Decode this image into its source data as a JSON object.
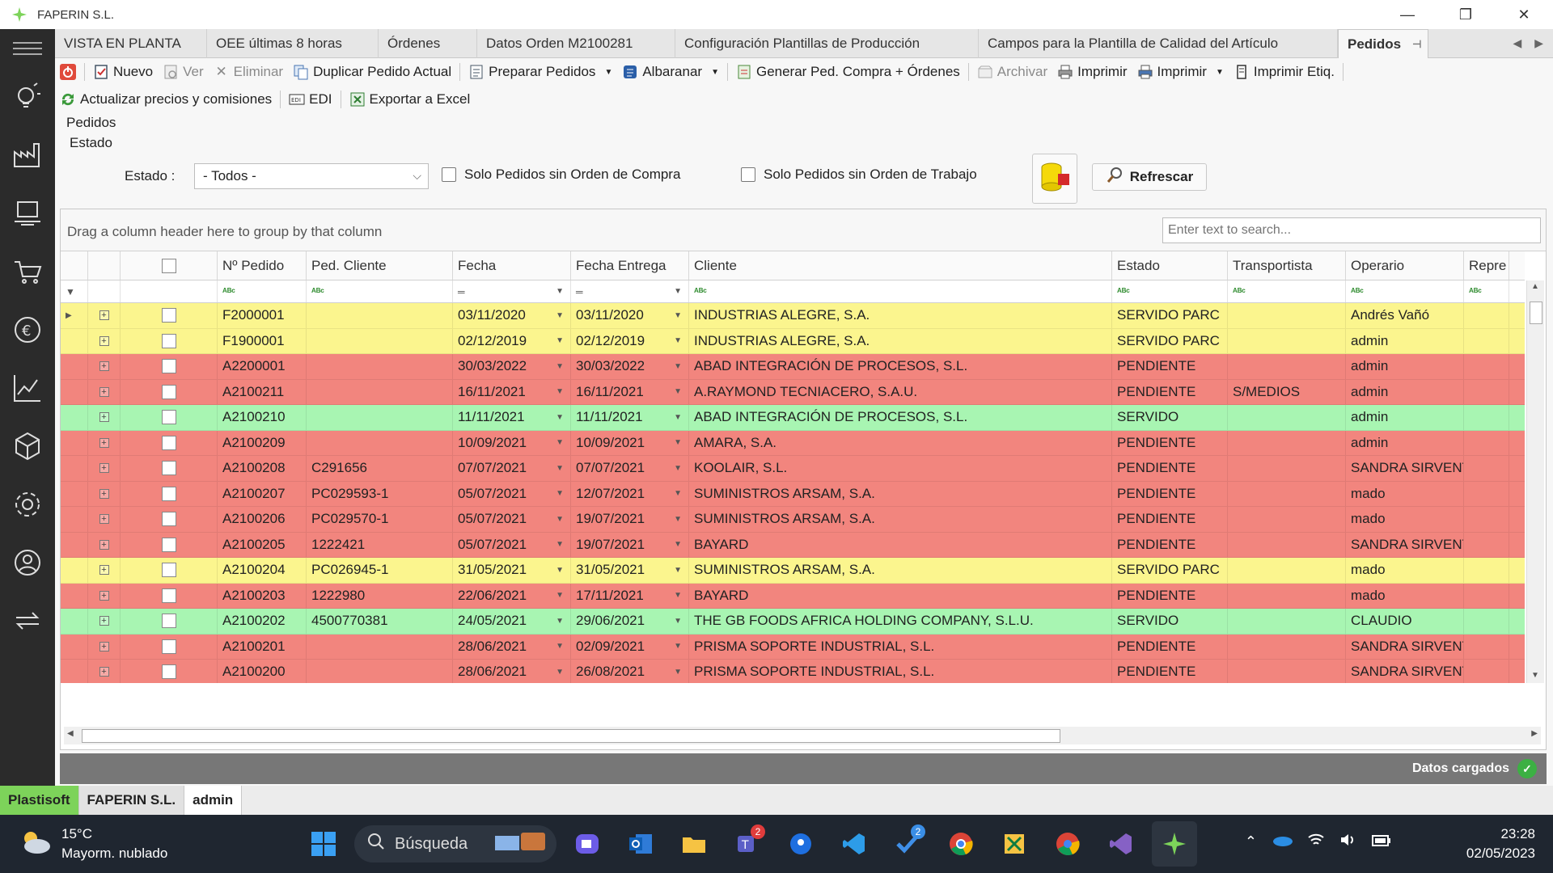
{
  "window": {
    "title": "FAPERIN S.L."
  },
  "tabs": [
    {
      "label": "VISTA EN PLANTA"
    },
    {
      "label": "OEE últimas 8 horas"
    },
    {
      "label": "Órdenes"
    },
    {
      "label": "Datos Orden M2100281"
    },
    {
      "label": "Configuración Plantillas de Producción"
    },
    {
      "label": "Campos para la Plantilla de Calidad del Artículo"
    },
    {
      "label": "Pedidos",
      "active": true
    }
  ],
  "toolbar": {
    "nuevo": "Nuevo",
    "ver": "Ver",
    "eliminar": "Eliminar",
    "duplicar": "Duplicar Pedido Actual",
    "preparar": "Preparar Pedidos",
    "albaranar": "Albaranar",
    "generar": "Generar Ped. Compra + Órdenes",
    "archivar": "Archivar",
    "imprimir1": "Imprimir",
    "imprimir2": "Imprimir",
    "imprimir_etiq": "Imprimir Etiq.",
    "actualizar": "Actualizar precios y comisiones",
    "edi": "EDI",
    "exportar": "Exportar a Excel"
  },
  "panel": {
    "pedidos_label": "Pedidos",
    "estado_group": "Estado",
    "estado_label": "Estado :",
    "estado_value": "- Todos -",
    "chk_compra": "Solo Pedidos sin Orden de Compra",
    "chk_trabajo": "Solo Pedidos sin Orden de Trabajo",
    "refrescar": "Refrescar"
  },
  "grid": {
    "group_hint": "Drag a column header here to group by that column",
    "search_placeholder": "Enter text to search...",
    "columns": [
      "Nº Pedido",
      "Ped. Cliente",
      "Fecha",
      "Fecha Entrega",
      "Cliente",
      "Estado",
      "Transportista",
      "Operario",
      "Repre"
    ],
    "colors": {
      "yellow": "#fbf58e",
      "red": "#f2857e",
      "green": "#a8f5b2"
    },
    "rows": [
      {
        "pedido": "F2000001",
        "ped_cliente": "",
        "fecha": "03/11/2020",
        "entrega": "03/11/2020",
        "cliente": "INDUSTRIAS ALEGRE, S.A.",
        "estado": "SERVIDO PARC",
        "transportista": "",
        "operario": "Andrés Vañó",
        "color": "yellow"
      },
      {
        "pedido": "F1900001",
        "ped_cliente": "",
        "fecha": "02/12/2019",
        "entrega": "02/12/2019",
        "cliente": "INDUSTRIAS ALEGRE, S.A.",
        "estado": "SERVIDO PARC",
        "transportista": "",
        "operario": "admin",
        "color": "yellow"
      },
      {
        "pedido": "A2200001",
        "ped_cliente": "",
        "fecha": "30/03/2022",
        "entrega": "30/03/2022",
        "cliente": "ABAD INTEGRACIÓN DE PROCESOS, S.L.",
        "estado": "PENDIENTE",
        "transportista": "",
        "operario": "admin",
        "color": "red"
      },
      {
        "pedido": "A2100211",
        "ped_cliente": "",
        "fecha": "16/11/2021",
        "entrega": "16/11/2021",
        "cliente": "A.RAYMOND TECNIACERO, S.A.U.",
        "estado": "PENDIENTE",
        "transportista": "S/MEDIOS",
        "operario": "admin",
        "color": "red"
      },
      {
        "pedido": "A2100210",
        "ped_cliente": "",
        "fecha": "11/11/2021",
        "entrega": "11/11/2021",
        "cliente": "ABAD INTEGRACIÓN DE PROCESOS, S.L.",
        "estado": "SERVIDO",
        "transportista": "",
        "operario": "admin",
        "color": "green"
      },
      {
        "pedido": "A2100209",
        "ped_cliente": "",
        "fecha": "10/09/2021",
        "entrega": "10/09/2021",
        "cliente": "AMARA, S.A.",
        "estado": "PENDIENTE",
        "transportista": "",
        "operario": "admin",
        "color": "red"
      },
      {
        "pedido": "A2100208",
        "ped_cliente": "C291656",
        "fecha": "07/07/2021",
        "entrega": "07/07/2021",
        "cliente": "KOOLAIR, S.L.",
        "estado": "PENDIENTE",
        "transportista": "",
        "operario": "SANDRA SIRVENT",
        "color": "red"
      },
      {
        "pedido": "A2100207",
        "ped_cliente": "PC029593-1",
        "fecha": "05/07/2021",
        "entrega": "12/07/2021",
        "cliente": "SUMINISTROS ARSAM, S.A.",
        "estado": "PENDIENTE",
        "transportista": "",
        "operario": "mado",
        "color": "red"
      },
      {
        "pedido": "A2100206",
        "ped_cliente": "PC029570-1",
        "fecha": "05/07/2021",
        "entrega": "19/07/2021",
        "cliente": "SUMINISTROS ARSAM, S.A.",
        "estado": "PENDIENTE",
        "transportista": "",
        "operario": "mado",
        "color": "red"
      },
      {
        "pedido": "A2100205",
        "ped_cliente": "1222421",
        "fecha": "05/07/2021",
        "entrega": "19/07/2021",
        "cliente": "BAYARD",
        "estado": "PENDIENTE",
        "transportista": "",
        "operario": "SANDRA SIRVENT",
        "color": "red"
      },
      {
        "pedido": "A2100204",
        "ped_cliente": "PC026945-1",
        "fecha": "31/05/2021",
        "entrega": "31/05/2021",
        "cliente": "SUMINISTROS ARSAM, S.A.",
        "estado": "SERVIDO PARC",
        "transportista": "",
        "operario": "mado",
        "color": "yellow"
      },
      {
        "pedido": "A2100203",
        "ped_cliente": "1222980",
        "fecha": "22/06/2021",
        "entrega": "17/11/2021",
        "cliente": "BAYARD",
        "estado": "PENDIENTE",
        "transportista": "",
        "operario": "mado",
        "color": "red"
      },
      {
        "pedido": "A2100202",
        "ped_cliente": "4500770381",
        "fecha": "24/05/2021",
        "entrega": "29/06/2021",
        "cliente": "THE GB FOODS AFRICA HOLDING COMPANY, S.L.U.",
        "estado": "SERVIDO",
        "transportista": "",
        "operario": "CLAUDIO",
        "color": "green"
      },
      {
        "pedido": "A2100201",
        "ped_cliente": "",
        "fecha": "28/06/2021",
        "entrega": "02/09/2021",
        "cliente": "PRISMA SOPORTE INDUSTRIAL, S.L.",
        "estado": "PENDIENTE",
        "transportista": "",
        "operario": "SANDRA SIRVENT",
        "color": "red"
      },
      {
        "pedido": "A2100200",
        "ped_cliente": "",
        "fecha": "28/06/2021",
        "entrega": "26/08/2021",
        "cliente": "PRISMA SOPORTE INDUSTRIAL, S.L.",
        "estado": "PENDIENTE",
        "transportista": "",
        "operario": "SANDRA SIRVENT",
        "color": "red"
      }
    ]
  },
  "status": {
    "text": "Datos cargados"
  },
  "bottom_tabs": [
    {
      "label": "Plastisoft",
      "bg": "#7dd35a"
    },
    {
      "label": "FAPERIN S.L.",
      "bg": "#e2e2e2"
    },
    {
      "label": "admin",
      "bg": "#ffffff"
    }
  ],
  "taskbar": {
    "temp": "15°C",
    "weather": "Mayorm. nublado",
    "search": "Búsqueda",
    "time": "23:28",
    "date": "02/05/2023",
    "teams_badge": "2",
    "todo_badge": "2"
  }
}
